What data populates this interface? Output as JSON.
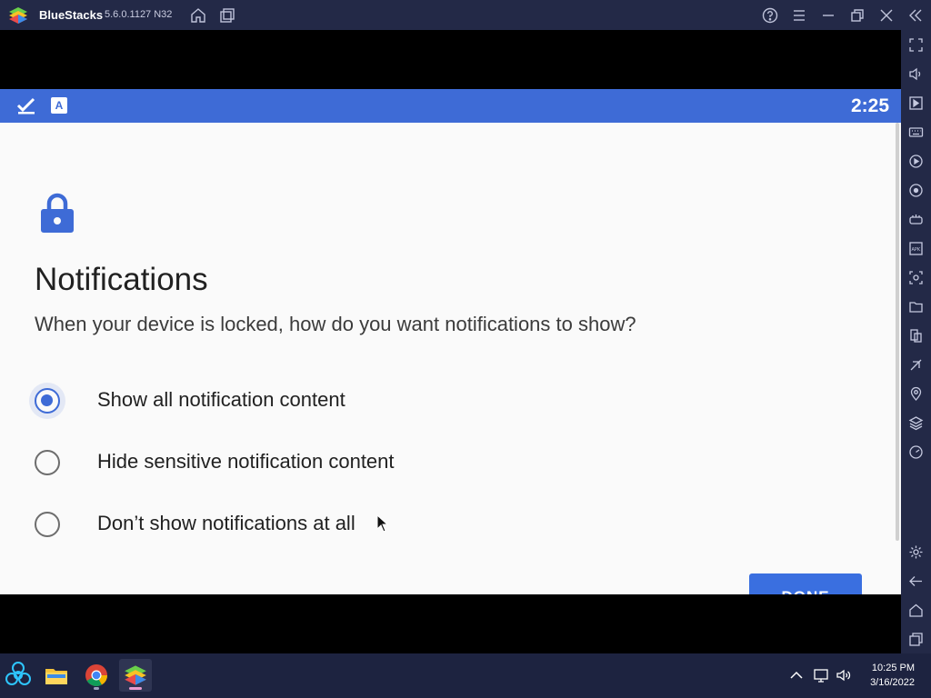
{
  "titlebar": {
    "app_name": "BlueStacks",
    "version": "5.6.0.1127 N32"
  },
  "statusbar": {
    "time": "2:25",
    "a_icon_letter": "A"
  },
  "screen": {
    "heading": "Notifications",
    "subtitle": "When your device is locked, how do you want notifications to show?",
    "options": [
      {
        "label": "Show all notification content",
        "selected": true
      },
      {
        "label": "Hide sensitive notification content",
        "selected": false
      },
      {
        "label": "Don’t show notifications at all",
        "selected": false
      }
    ],
    "done_label": "DONE"
  },
  "taskbar": {
    "time": "10:25 PM",
    "date": "3/16/2022"
  },
  "colors": {
    "accent": "#3e6bd6",
    "titlebar_bg": "#232947",
    "taskbar_bg": "#1d2340"
  }
}
